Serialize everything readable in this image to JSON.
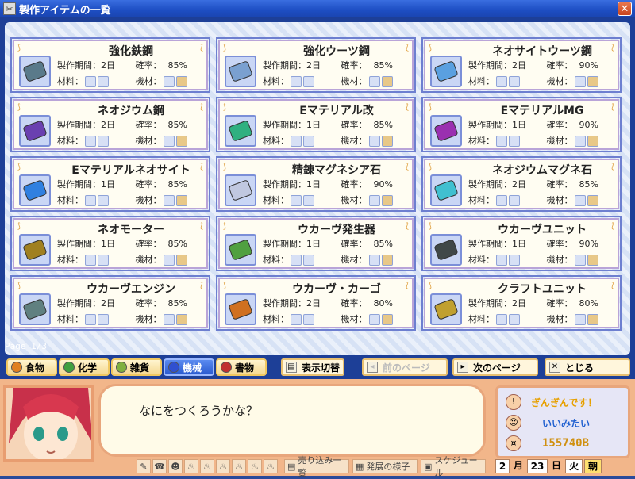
{
  "window": {
    "title": "製作アイテムの一覧",
    "close_label": "✕"
  },
  "labels": {
    "time": "製作期間：",
    "rate": "確率：",
    "material": "材料：",
    "machine": "機材："
  },
  "items": [
    {
      "name": "強化鉄鋼",
      "time": "2日",
      "rate": "85%",
      "color": "#5a7a8a"
    },
    {
      "name": "強化ウーツ鋼",
      "time": "2日",
      "rate": "85%",
      "color": "#7aa0d0"
    },
    {
      "name": "ネオサイトウーツ鋼",
      "time": "2日",
      "rate": "90%",
      "color": "#5aa0e0"
    },
    {
      "name": "ネオジウム鋼",
      "time": "2日",
      "rate": "85%",
      "color": "#6a40b0"
    },
    {
      "name": "Eマテリアル改",
      "time": "1日",
      "rate": "85%",
      "color": "#30b080"
    },
    {
      "name": "EマテリアルMG",
      "time": "1日",
      "rate": "90%",
      "color": "#9a30b0"
    },
    {
      "name": "Eマテリアルネオサイト",
      "time": "1日",
      "rate": "85%",
      "color": "#3080e0"
    },
    {
      "name": "精錬マグネシア石",
      "time": "1日",
      "rate": "90%",
      "color": "#c0c8e0"
    },
    {
      "name": "ネオジウムマグネ石",
      "time": "2日",
      "rate": "85%",
      "color": "#40c0d0"
    },
    {
      "name": "ネオモーター",
      "time": "1日",
      "rate": "85%",
      "color": "#a08020"
    },
    {
      "name": "ウカーヴ発生器",
      "time": "1日",
      "rate": "85%",
      "color": "#50a040"
    },
    {
      "name": "ウカーヴユニット",
      "time": "1日",
      "rate": "90%",
      "color": "#404848"
    },
    {
      "name": "ウカーヴエンジン",
      "time": "2日",
      "rate": "85%",
      "color": "#608080"
    },
    {
      "name": "ウカーヴ・カーゴ",
      "time": "2日",
      "rate": "80%",
      "color": "#d07020"
    },
    {
      "name": "クラフトユニット",
      "time": "2日",
      "rate": "80%",
      "color": "#c0a030"
    }
  ],
  "page_indicator": "Page 1/3",
  "categories": [
    {
      "label": "食物",
      "color": "#e08020"
    },
    {
      "label": "化学",
      "color": "#40a040"
    },
    {
      "label": "雑貨",
      "color": "#80b040"
    },
    {
      "label": "機械",
      "color": "#3050d0"
    },
    {
      "label": "書物",
      "color": "#c03030"
    }
  ],
  "toggle_label": "表示切替",
  "prev_label": "前のページ",
  "next_label": "次のページ",
  "close_label": "とじる",
  "message": "なにをつくろうかな？",
  "status": {
    "line1": "ぎんぎんです！",
    "line2": "いいみたい",
    "money": "155740B"
  },
  "toolbar": {
    "sales": "売り込み一覧",
    "progress": "発展の様子",
    "schedule": "スケジュール"
  },
  "date": {
    "month": "2",
    "month_unit": "月",
    "day": "23",
    "day_unit": "日",
    "weekday": "火",
    "period": "朝"
  }
}
